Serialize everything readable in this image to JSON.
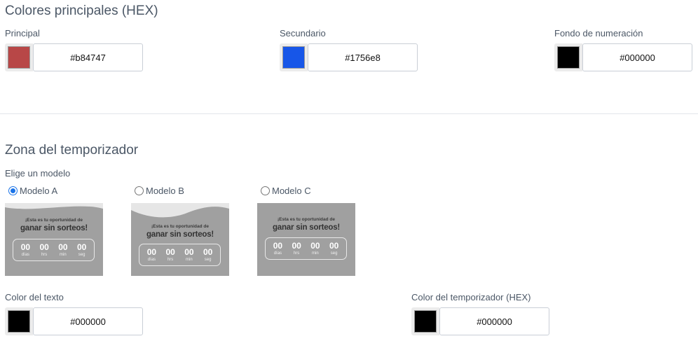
{
  "main_colors": {
    "title": "Colores principales (HEX)",
    "fields": [
      {
        "label": "Principal",
        "value": "#b84747",
        "swatch": "#b84747"
      },
      {
        "label": "Secundario",
        "value": "#1756e8",
        "swatch": "#1756e8"
      },
      {
        "label": "Fondo de numeración",
        "value": "#000000",
        "swatch": "#000000"
      }
    ]
  },
  "timer_zone": {
    "title": "Zona del temporizador",
    "model_prompt": "Elige un modelo",
    "models": [
      {
        "label": "Modelo A",
        "selected": true
      },
      {
        "label": "Modelo B",
        "selected": false
      },
      {
        "label": "Modelo C",
        "selected": false
      }
    ],
    "preview": {
      "line1": "¡Esta es tu oportunidad de",
      "line2": "ganar sin sorteos!",
      "units": [
        {
          "value": "00",
          "label": "días"
        },
        {
          "value": "00",
          "label": "hrs"
        },
        {
          "value": "00",
          "label": "min"
        },
        {
          "value": "00",
          "label": "seg"
        }
      ]
    },
    "text_color": {
      "label": "Color del texto",
      "value": "#000000",
      "swatch": "#000000"
    },
    "timer_color": {
      "label": "Color del temporizador (HEX)",
      "value": "#000000",
      "swatch": "#000000"
    }
  }
}
